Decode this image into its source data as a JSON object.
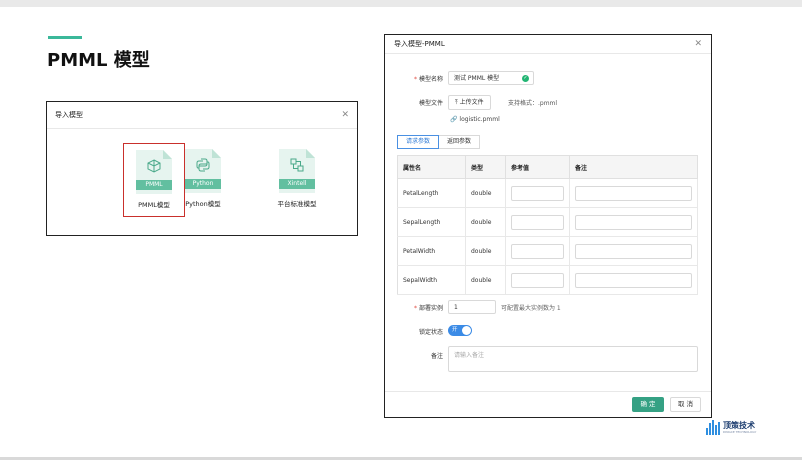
{
  "slide": {
    "title": "PMML 模型",
    "accent_color": "#3bb89a"
  },
  "import_dialog": {
    "title": "导入模型",
    "close_icon": "close-icon",
    "items": [
      {
        "tag": "PMML",
        "label": "PMML模型",
        "icon": "cube-icon",
        "selected": true
      },
      {
        "tag": "Python",
        "label": "Python模型",
        "icon": "python-icon",
        "selected": false
      },
      {
        "tag": "Xintell",
        "label": "平台标准模型",
        "icon": "flow-diagram-icon",
        "selected": false
      }
    ]
  },
  "pmml_dialog": {
    "title": "导入模型-PMML",
    "model_name_label": "模型名称",
    "model_name_value": "测试 PMML 模型",
    "model_file_label": "模型文件",
    "upload_button": "上传文件",
    "format_hint": "支持格式：.pmml",
    "uploaded_file": "logistic.pmml",
    "tabs": [
      "请求参数",
      "返回参数"
    ],
    "table": {
      "headers": [
        "属性名",
        "类型",
        "参考值",
        "备注"
      ],
      "rows": [
        {
          "name": "PetalLength",
          "type": "double"
        },
        {
          "name": "SepalLength",
          "type": "double"
        },
        {
          "name": "PetalWidth",
          "type": "double"
        },
        {
          "name": "SepalWidth",
          "type": "double"
        }
      ]
    },
    "instances_label": "部署实例",
    "instances_value": "1",
    "instances_hint": "可配置最大实例数为 1",
    "lock_label": "锁定状态",
    "lock_toggle_text": "开",
    "remark_label": "备注",
    "remark_placeholder": "请输入备注",
    "ok_button": "确 定",
    "cancel_button": "取 消"
  },
  "logo": {
    "text": "顶策技术",
    "subtext": "DINGCE TECHNOLOGY"
  }
}
